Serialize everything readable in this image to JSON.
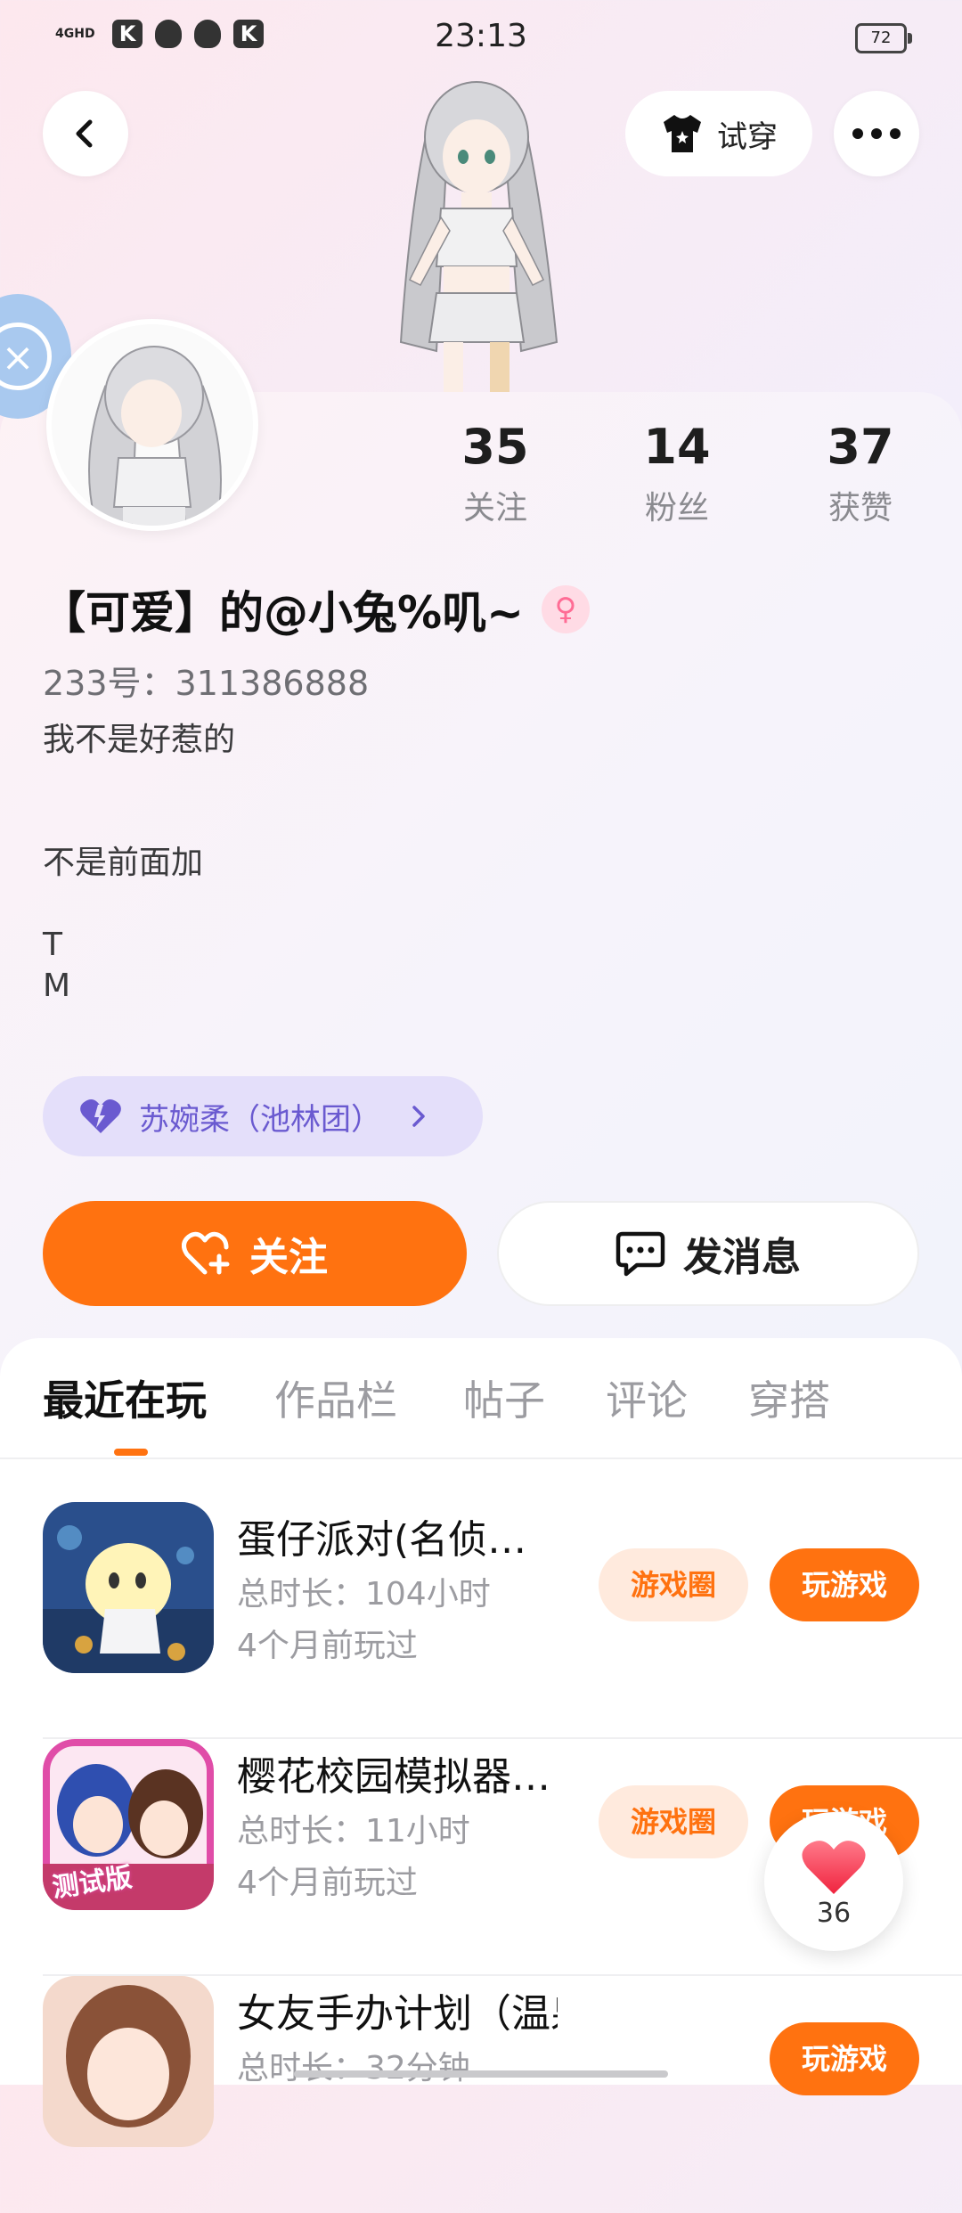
{
  "status_bar": {
    "network": "4GHD",
    "time": "23:13",
    "battery": "72",
    "notification_icons": [
      "k-app-icon",
      "qq-icon",
      "qq-icon",
      "k-app-icon"
    ]
  },
  "header": {
    "try_on_label": "试穿"
  },
  "profile": {
    "stats": [
      {
        "value": "35",
        "label": "关注"
      },
      {
        "value": "14",
        "label": "粉丝"
      },
      {
        "value": "37",
        "label": "获赞"
      }
    ],
    "username": "【可爱】的@小兔%叽~",
    "gender_symbol": "♀",
    "uid": "233号：311386888",
    "bio": "我不是好惹的\n\n\n不是前面加\n\nT\nM",
    "guild": "苏婉柔（池林团）"
  },
  "actions": {
    "follow_label": "关注",
    "message_label": "发消息"
  },
  "tabs": [
    {
      "label": "最近在玩",
      "active": true
    },
    {
      "label": "作品栏",
      "active": false
    },
    {
      "label": "帖子",
      "active": false
    },
    {
      "label": "评论",
      "active": false
    },
    {
      "label": "穿搭",
      "active": false
    }
  ],
  "games": [
    {
      "title": "蛋仔派对(名侦…",
      "duration": "总时长：104小时",
      "last_played": "4个月前玩过",
      "circle_label": "游戏圈",
      "play_label": "玩游戏"
    },
    {
      "title": "樱花校园模拟器…",
      "duration": "总时长：11小时",
      "last_played": "4个月前玩过",
      "circle_label": "游戏圈",
      "play_label": "玩游戏",
      "icon_badge": "测试版"
    },
    {
      "title": "女友手办计划（温泉篇）",
      "duration": "总时长：32分钟",
      "play_label": "玩游戏"
    }
  ],
  "favorite": {
    "count": "36"
  },
  "colors": {
    "accent": "#ff7210",
    "guild_bg": "#e4dffa",
    "guild_text": "#6a5ad0"
  }
}
